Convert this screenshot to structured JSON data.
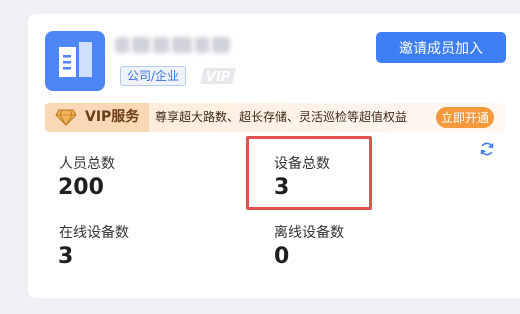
{
  "company": {
    "type_tag": "公司/企业",
    "vip_mark": "VIP"
  },
  "header": {
    "invite_button": "邀请成员加入"
  },
  "vip": {
    "title": "VIP服务",
    "description": "尊享超大路数、超长存储、灵活巡检等超值权益",
    "open_button": "立即开通",
    "colors": {
      "accent": "#f59a3c",
      "bar": "#fde9d5"
    }
  },
  "stats": {
    "members": {
      "label": "人员总数",
      "value": "200"
    },
    "devices": {
      "label": "设备总数",
      "value": "3"
    },
    "online": {
      "label": "在线设备数",
      "value": "3"
    },
    "offline": {
      "label": "离线设备数",
      "value": "0"
    }
  },
  "icons": {
    "logo": "building-icon",
    "refresh": "refresh-icon",
    "vip": "diamond-icon"
  },
  "colors": {
    "primary": "#3d7ef5",
    "highlight": "#e35050"
  }
}
